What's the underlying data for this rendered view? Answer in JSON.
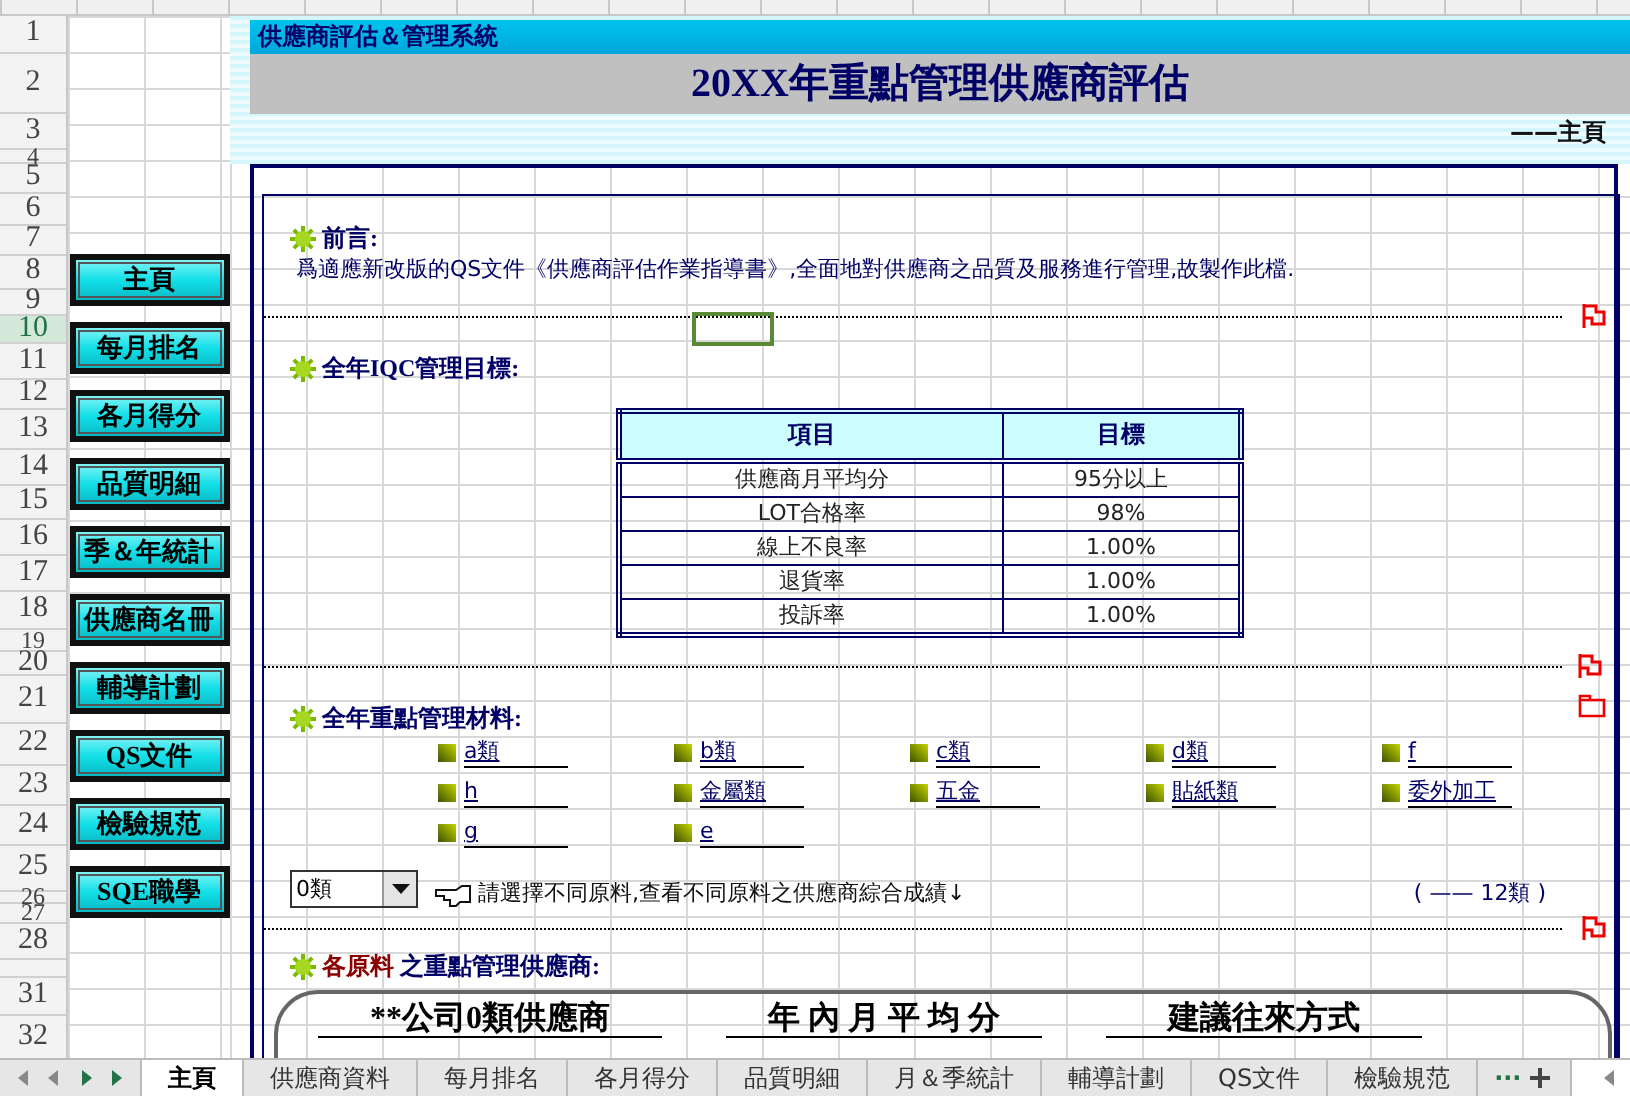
{
  "row_headers": [
    {
      "label": "1",
      "selected": false
    },
    {
      "label": "2",
      "selected": false
    },
    {
      "label": "3",
      "selected": false
    },
    {
      "label": "4",
      "selected": false
    },
    {
      "label": "5",
      "selected": false
    },
    {
      "label": "6",
      "selected": false
    },
    {
      "label": "7",
      "selected": false
    },
    {
      "label": "8",
      "selected": false
    },
    {
      "label": "9",
      "selected": false
    },
    {
      "label": "10",
      "selected": true
    },
    {
      "label": "11",
      "selected": false
    },
    {
      "label": "12",
      "selected": false
    },
    {
      "label": "13",
      "selected": false
    },
    {
      "label": "14",
      "selected": false
    },
    {
      "label": "15",
      "selected": false
    },
    {
      "label": "16",
      "selected": false
    },
    {
      "label": "17",
      "selected": false
    },
    {
      "label": "18",
      "selected": false
    },
    {
      "label": "19",
      "selected": false
    },
    {
      "label": "20",
      "selected": false
    },
    {
      "label": "21",
      "selected": false
    },
    {
      "label": "22",
      "selected": false
    },
    {
      "label": "23",
      "selected": false
    },
    {
      "label": "24",
      "selected": false
    },
    {
      "label": "25",
      "selected": false
    },
    {
      "label": "26",
      "selected": false
    },
    {
      "label": "27",
      "selected": false
    },
    {
      "label": "28",
      "selected": false
    },
    {
      "label": "31",
      "selected": false
    },
    {
      "label": "32",
      "selected": false
    }
  ],
  "nav_buttons": [
    "主頁",
    "每月排名",
    "各月得分",
    "品質明細",
    "季＆年統計",
    "供應商名冊",
    "輔導計劃",
    "QS文件",
    "檢驗規范",
    "SQE職學"
  ],
  "app_title": "供應商評估＆管理系統",
  "banner_title": "20XX年重點管理供應商評估",
  "page_label": "——主頁",
  "sections": [
    {
      "kind": "text",
      "title": "前言:",
      "body": "爲適應新改版的QS文件《供應商評估作業指導書》,全面地對供應商之品質及服務進行管理,故製作此檔.",
      "flag": true,
      "folder": false
    },
    {
      "kind": "table",
      "title": "全年IQC管理目標:",
      "columns": [
        "項目",
        "目標"
      ],
      "rows": [
        [
          "供應商月平均分",
          "95分以上"
        ],
        [
          "LOT合格率",
          "98%"
        ],
        [
          "線上不良率",
          "1.00%"
        ],
        [
          "退貨率",
          "1.00%"
        ],
        [
          "投訴率",
          "1.00%"
        ]
      ],
      "flag": true,
      "folder": true
    },
    {
      "kind": "materials",
      "title": "全年重點管理材料:",
      "links": [
        "a類",
        "b類",
        "c類",
        "d類",
        "f",
        "h",
        "金屬類",
        "五金",
        "貼紙類",
        "委外加工",
        "g",
        "e"
      ],
      "dropdown": {
        "value": "0類"
      },
      "hint": "請選擇不同原料,查看不同原料之供應商綜合成績↓",
      "count": "( —— 12類 )",
      "flag": true,
      "folder": false
    },
    {
      "kind": "suppliers",
      "title_highlight": "各原料",
      "title": "之重點管理供應商:",
      "columns": [
        "**公司0類供應商",
        "年 內 月 平 均 分",
        "建議往來方式"
      ],
      "flag": false,
      "folder": false
    }
  ],
  "sheet_tabs": [
    {
      "label": "主頁",
      "selected": true
    },
    {
      "label": "供應商資料",
      "selected": false
    },
    {
      "label": "每月排名",
      "selected": false
    },
    {
      "label": "各月得分",
      "selected": false
    },
    {
      "label": "品質明細",
      "selected": false
    },
    {
      "label": "月＆季統計",
      "selected": false
    },
    {
      "label": "輔導計劃",
      "selected": false
    },
    {
      "label": "QS文件",
      "selected": false
    },
    {
      "label": "檢驗規范",
      "selected": false
    }
  ],
  "more_tabs": "···"
}
